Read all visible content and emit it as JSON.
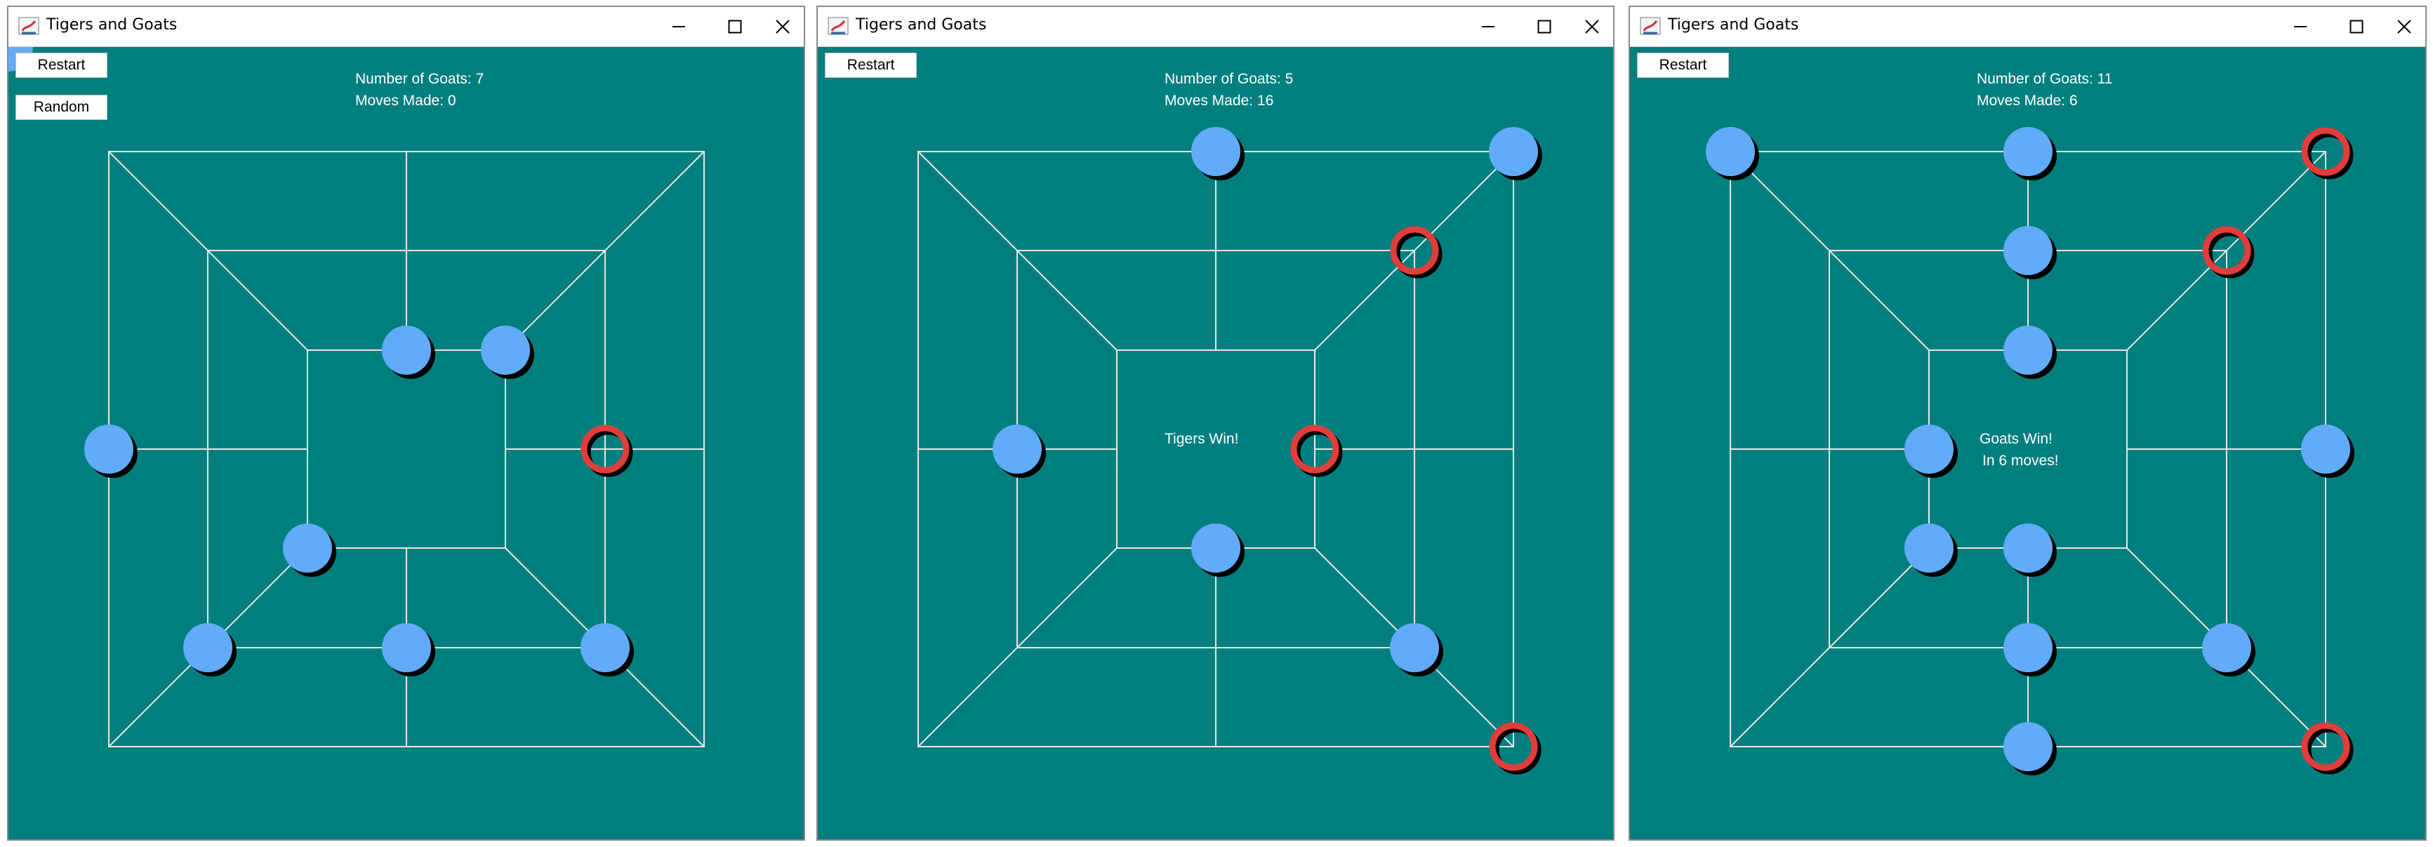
{
  "windows": [
    {
      "title": "Tigers and Goats",
      "buttons": [
        "Restart",
        "Random"
      ],
      "goats_label": "Number of Goats: 7",
      "moves_label": "Moves Made: 0",
      "status": "",
      "status2": "",
      "goats": [
        "7",
        "12",
        "13",
        "17",
        "18",
        "14",
        "22",
        "24"
      ],
      "tigers": [
        "11"
      ]
    },
    {
      "title": "Tigers and Goats",
      "buttons": [
        "Restart"
      ],
      "goats_label": "Number of Goats: 5",
      "moves_label": "Moves Made: 16",
      "status": "Tigers Win!",
      "status2": "",
      "goats": [
        "1",
        "2",
        "12",
        "21",
        "15"
      ],
      "tigers": [
        "4",
        "10",
        "19"
      ]
    },
    {
      "title": "Tigers and Goats",
      "buttons": [
        "Restart"
      ],
      "goats_label": "Number of Goats: 11",
      "moves_label": "Moves Made: 6",
      "status": "Goats Win!",
      "status2": "In 6 moves!",
      "goats": [
        "0",
        "1",
        "3",
        "5",
        "9",
        "12",
        "13",
        "17",
        "21",
        "22",
        "23"
      ],
      "tigers": [
        "2",
        "4",
        "10"
      ]
    }
  ],
  "colors": {
    "board_bg": "#017f7f",
    "line": "#e8e8e8",
    "goat": "#62abf8",
    "tiger_ring": "#e23d3a",
    "shadow": "#000000"
  }
}
